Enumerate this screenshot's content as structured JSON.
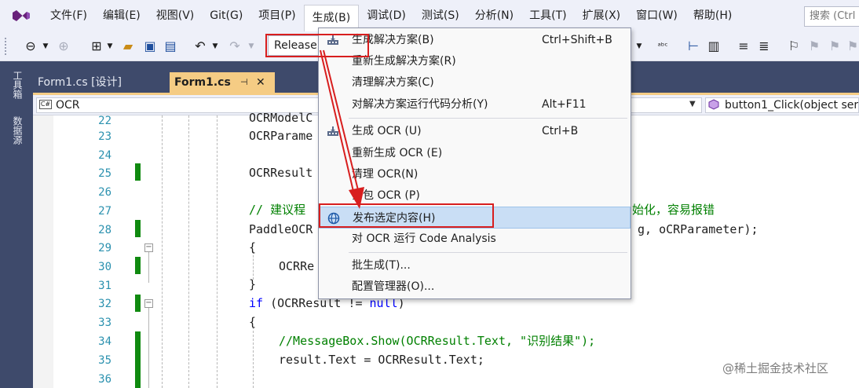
{
  "menu": {
    "items": [
      "文件(F)",
      "编辑(E)",
      "视图(V)",
      "Git(G)",
      "项目(P)",
      "生成(B)",
      "调试(D)",
      "测试(S)",
      "分析(N)",
      "工具(T)",
      "扩展(X)",
      "窗口(W)",
      "帮助(H)"
    ],
    "active_index": 5,
    "search_placeholder": "搜索 (Ctrl"
  },
  "toolbar": {
    "configuration": "Release"
  },
  "sidebar": {
    "toolbox": "工具箱",
    "datasources": "数据源"
  },
  "tabs": {
    "inactive": "Form1.cs [设计]",
    "active": "Form1.cs",
    "pin": "⊣",
    "close": "✕"
  },
  "navbar": {
    "project": "OCR",
    "project_badge": "C#",
    "member": "button1_Click(object ser"
  },
  "editor": {
    "line_numbers": [
      "22",
      "23",
      "24",
      "25",
      "26",
      "27",
      "28",
      "29",
      "30",
      "31",
      "32",
      "33",
      "34",
      "35",
      "36"
    ],
    "code": {
      "l22": "OCRModelC",
      "l23": "OCRParame",
      "l25": "OCRResult",
      "l27": "// 建议程",
      "l27_right": "始化，容易报错",
      "l28": "PaddleOCR",
      "l28_right": "g, oCRParameter);",
      "l29": "{",
      "l30": "OCRRe",
      "l31": "}",
      "l32_kw": "if",
      "l32_rest": " (OCRResult != ",
      "l32_null": "null",
      "l32_end": ")",
      "l33": "{",
      "l34": "//MessageBox.Show(OCRResult.Text, \"识别结果\");",
      "l35": "result.Text = OCRResult.Text;"
    }
  },
  "build_menu": {
    "items": [
      {
        "label": "生成解决方案(B)",
        "shortcut": "Ctrl+Shift+B",
        "icon": "build-solution-icon"
      },
      {
        "label": "重新生成解决方案(R)",
        "shortcut": ""
      },
      {
        "label": "清理解决方案(C)",
        "shortcut": ""
      },
      {
        "label": "对解决方案运行代码分析(Y)",
        "shortcut": "Alt+F11"
      },
      {
        "label": "生成 OCR (U)",
        "shortcut": "Ctrl+B",
        "icon": "build-project-icon"
      },
      {
        "label": "重新生成 OCR (E)",
        "shortcut": ""
      },
      {
        "label": "清理 OCR(N)",
        "shortcut": ""
      },
      {
        "label": "打包 OCR (P)",
        "shortcut": ""
      },
      {
        "label": "发布选定内容(H)",
        "shortcut": "",
        "icon": "publish-globe-icon",
        "highlighted": true
      },
      {
        "label": "对 OCR 运行 Code Analysis",
        "shortcut": ""
      },
      {
        "label": "批生成(T)...",
        "shortcut": ""
      },
      {
        "label": "配置管理器(O)...",
        "shortcut": ""
      }
    ]
  },
  "watermark": "@稀土掘金技术社区",
  "colors": {
    "accent_red": "#d81e1e",
    "tab_active": "#f5cc84",
    "chrome_dark": "#3e4a6b",
    "highlight": "#c9def5"
  }
}
